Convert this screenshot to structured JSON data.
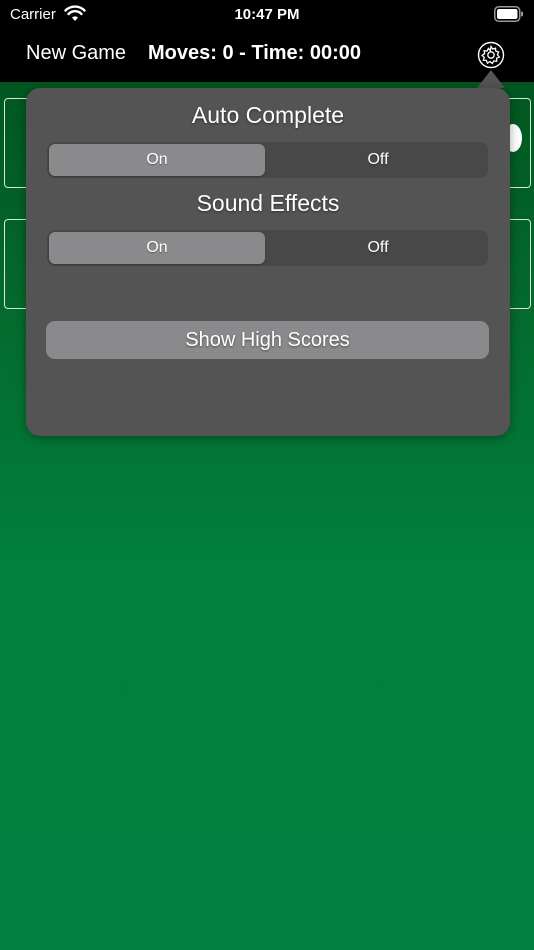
{
  "status_bar": {
    "carrier": "Carrier",
    "time": "10:47 PM"
  },
  "toolbar": {
    "new_game_label": "New Game",
    "moves_time": "Moves: 0 - Time: 00:00",
    "settings_icon": "gear-icon"
  },
  "popover": {
    "auto_complete": {
      "title": "Auto Complete",
      "options": [
        "On",
        "Off"
      ],
      "selected": "On"
    },
    "sound_effects": {
      "title": "Sound Effects",
      "options": [
        "On",
        "Off"
      ],
      "selected": "On"
    },
    "high_scores_label": "Show High Scores"
  },
  "colors": {
    "felt_green": "#007f3e",
    "popover_bg": "#545454",
    "segment_selected": "#8a8a8c",
    "toolbar_bg": "#000000"
  }
}
